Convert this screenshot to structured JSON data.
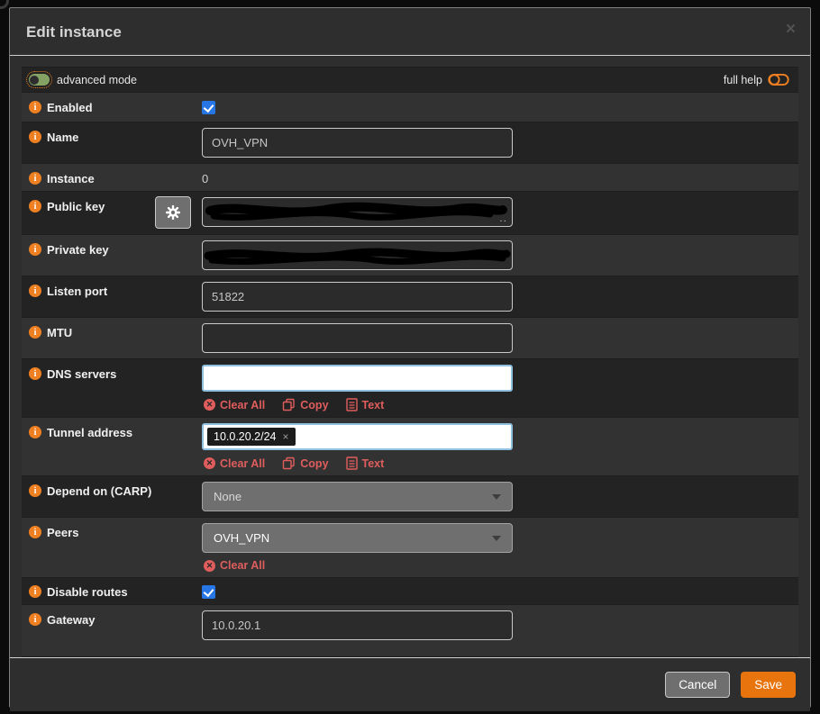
{
  "modal": {
    "title": "Edit instance",
    "close_glyph": "×"
  },
  "help_bar": {
    "advanced_mode_label": "advanced mode",
    "full_help_label": "full help"
  },
  "token_actions": {
    "clear_all": "Clear All",
    "copy": "Copy",
    "text": "Text"
  },
  "icons": {
    "info_glyph": "i",
    "clear_glyph": "✕"
  },
  "fields": [
    {
      "id": "enabled",
      "label": "Enabled",
      "type": "checkbox",
      "checked": true
    },
    {
      "id": "name",
      "label": "Name",
      "type": "text",
      "value": "OVH_VPN"
    },
    {
      "id": "instance",
      "label": "Instance",
      "type": "static",
      "value": "0"
    },
    {
      "id": "public_key",
      "label": "Public key",
      "type": "text",
      "value": "",
      "redacted": true,
      "trailing_text": "..",
      "has_generate_button": true
    },
    {
      "id": "private_key",
      "label": "Private key",
      "type": "text",
      "value": "",
      "redacted": true
    },
    {
      "id": "listen_port",
      "label": "Listen port",
      "type": "text",
      "value": "51822"
    },
    {
      "id": "mtu",
      "label": "MTU",
      "type": "text",
      "value": ""
    },
    {
      "id": "dns_servers",
      "label": "DNS servers",
      "type": "tokenizer",
      "tokens": []
    },
    {
      "id": "tunnel_address",
      "label": "Tunnel address",
      "type": "tokenizer",
      "tokens": [
        "10.0.20.2/24"
      ],
      "token_remove_glyph": "×"
    },
    {
      "id": "carp_depend",
      "label": "Depend on (CARP)",
      "type": "select",
      "value": "None",
      "muted": true
    },
    {
      "id": "peers",
      "label": "Peers",
      "type": "select",
      "value": "OVH_VPN"
    },
    {
      "id": "disable_routes",
      "label": "Disable routes",
      "type": "checkbox",
      "checked": true
    },
    {
      "id": "gateway",
      "label": "Gateway",
      "type": "text",
      "value": "10.0.20.1"
    }
  ],
  "footer": {
    "cancel_label": "Cancel",
    "save_label": "Save"
  },
  "colors": {
    "info_orange": "#ee8022",
    "checkbox_blue": "#2776e6",
    "link_red": "#e05d5d",
    "save_orange": "#e8740e",
    "toggle_green": "#85a164",
    "token_focus_border": "#8fc0df"
  }
}
